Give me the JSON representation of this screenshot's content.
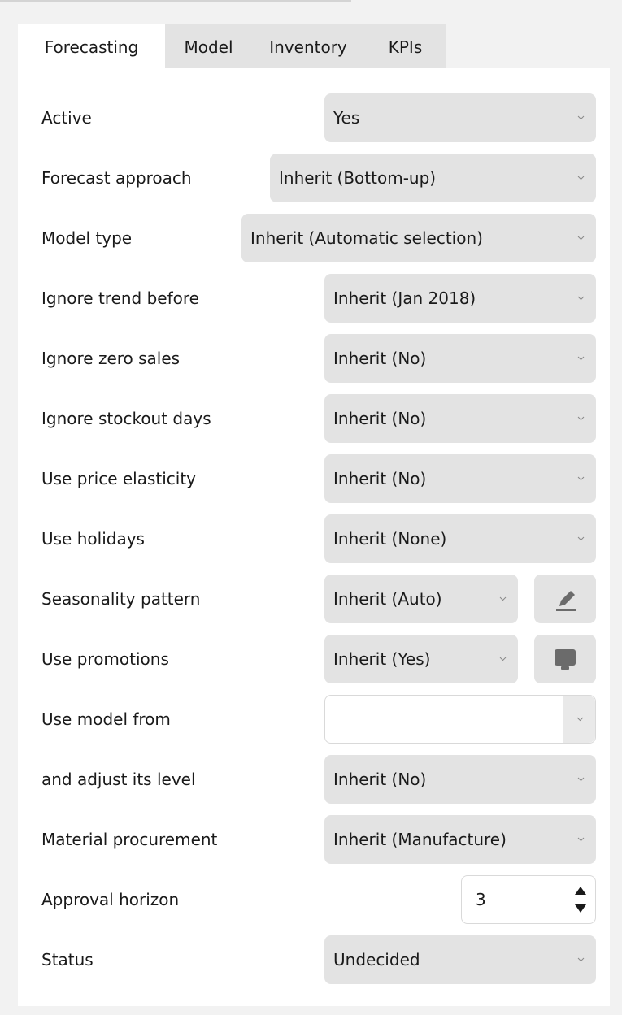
{
  "tabs": [
    {
      "label": "Forecasting",
      "active": true
    },
    {
      "label": "Model",
      "active": false
    },
    {
      "label": "Inventory",
      "active": false
    },
    {
      "label": "KPIs",
      "active": false
    }
  ],
  "fields": {
    "active": {
      "label": "Active",
      "value": "Yes"
    },
    "forecast_approach": {
      "label": "Forecast approach",
      "value": "Inherit (Bottom-up)"
    },
    "model_type": {
      "label": "Model type",
      "value": "Inherit (Automatic selection)"
    },
    "ignore_trend_before": {
      "label": "Ignore trend before",
      "value": "Inherit (Jan 2018)"
    },
    "ignore_zero_sales": {
      "label": "Ignore zero sales",
      "value": "Inherit (No)"
    },
    "ignore_stockout_days": {
      "label": "Ignore stockout days",
      "value": "Inherit (No)"
    },
    "use_price_elasticity": {
      "label": "Use price elasticity",
      "value": "Inherit (No)"
    },
    "use_holidays": {
      "label": "Use holidays",
      "value": "Inherit (None)"
    },
    "seasonality_pattern": {
      "label": "Seasonality pattern",
      "value": "Inherit (Auto)",
      "icon": "pencil-icon"
    },
    "use_promotions": {
      "label": "Use promotions",
      "value": "Inherit (Yes)",
      "icon": "monitor-icon"
    },
    "use_model_from": {
      "label": "Use model from",
      "value": ""
    },
    "adjust_level": {
      "label": "and adjust its level",
      "value": "Inherit (No)"
    },
    "material_procurement": {
      "label": "Material procurement",
      "value": "Inherit (Manufacture)"
    },
    "approval_horizon": {
      "label": "Approval horizon",
      "value": "3"
    },
    "status": {
      "label": "Status",
      "value": "Undecided"
    }
  },
  "colors": {
    "page_bg": "#f2f2f2",
    "panel_bg": "#ffffff",
    "control_bg": "#e3e3e3",
    "icon_color": "#6b6b6b"
  }
}
